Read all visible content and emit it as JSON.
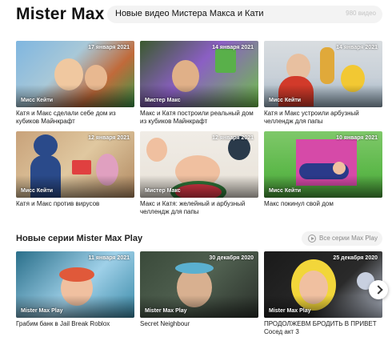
{
  "header": {
    "logo": "Mister Max",
    "search_text": "Новые видео Мистера Макса и Кати",
    "video_count": "980 видео"
  },
  "videos": [
    {
      "date": "17 января 2021",
      "channel": "Мисс Кейти",
      "title": "Катя и Макс сделали себе дом из кубиков Майнкрафт",
      "colors": [
        "#7fb6e0",
        "#c06a3a",
        "#3c9a4a"
      ]
    },
    {
      "date": "14 января 2021",
      "channel": "Мистер Макс",
      "title": "Макс и Катя построили реальный дом из кубиков Майнкрафт",
      "colors": [
        "#3a5a2e",
        "#8b5fc4",
        "#6fc04a"
      ]
    },
    {
      "date": "14 января 2021",
      "channel": "Мисс Кейти",
      "title": "Катя и Макс устроили арбузный челлендж для папы",
      "colors": [
        "#d9dde0",
        "#d23a2a",
        "#f2c833"
      ]
    },
    {
      "date": "12 января 2021",
      "channel": "Мисс Кейти",
      "title": "Катя и Макс против вирусов",
      "colors": [
        "#c8a27a",
        "#2a4a8a",
        "#e0a0c0"
      ]
    },
    {
      "date": "12 января 2021",
      "channel": "Мистер Макс",
      "title": "Макс и Катя: желейный и арбузный челлендж для папы",
      "colors": [
        "#f0ece6",
        "#2f7a3a",
        "#e63a4a"
      ]
    },
    {
      "date": "10 января 2021",
      "channel": "Мисс Кейти",
      "title": "Макс покинул свой дом",
      "colors": [
        "#5db84a",
        "#d64aa8",
        "#2a3a8a"
      ]
    }
  ],
  "section": {
    "title": "Новые серии Mister Max Play",
    "all_series": "Все серии Max Play"
  },
  "series": [
    {
      "date": "11 января 2021",
      "channel": "Mister Max Play",
      "title": "Грабим банк в Jail Break Roblox",
      "colors": [
        "#2a6f8a",
        "#e0593a",
        "#9fd0e8"
      ]
    },
    {
      "date": "30 декабря 2020",
      "channel": "Mister Max Play",
      "title": "Secret Neighbour",
      "colors": [
        "#3a4a3a",
        "#5ab0d0",
        "#d8b090"
      ]
    },
    {
      "date": "25 декабря 2020",
      "channel": "Mister Max Play",
      "title": "ПРОДОЛЖЕВМ БРОДИТЬ В ПРИВЕТ Сосед акт 3",
      "colors": [
        "#f2d63a",
        "#1a1a1a",
        "#c8d0e0"
      ]
    }
  ]
}
